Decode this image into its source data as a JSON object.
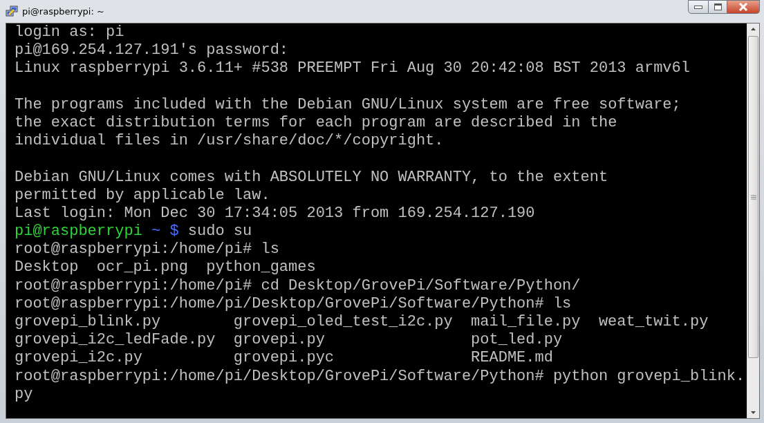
{
  "window": {
    "title": "pi@raspberrypi: ~"
  },
  "terminal": {
    "lines": [
      {
        "kind": "text",
        "text": "login as: pi"
      },
      {
        "kind": "text",
        "text": "pi@169.254.127.191's password:"
      },
      {
        "kind": "text",
        "text": "Linux raspberrypi 3.6.11+ #538 PREEMPT Fri Aug 30 20:42:08 BST 2013 armv6l"
      },
      {
        "kind": "blank"
      },
      {
        "kind": "text",
        "text": "The programs included with the Debian GNU/Linux system are free software;"
      },
      {
        "kind": "text",
        "text": "the exact distribution terms for each program are described in the"
      },
      {
        "kind": "text",
        "text": "individual files in /usr/share/doc/*/copyright."
      },
      {
        "kind": "blank"
      },
      {
        "kind": "text",
        "text": "Debian GNU/Linux comes with ABSOLUTELY NO WARRANTY, to the extent"
      },
      {
        "kind": "text",
        "text": "permitted by applicable law."
      },
      {
        "kind": "text",
        "text": "Last login: Mon Dec 30 17:34:05 2013 from 169.254.127.190"
      },
      {
        "kind": "color-prompt",
        "user_host": "pi@raspberrypi",
        "path_prompt": "~ $",
        "command": "sudo su"
      },
      {
        "kind": "prompt",
        "prompt": "root@raspberrypi:/home/pi#",
        "command": "ls"
      },
      {
        "kind": "listing",
        "rows": [
          [
            "Desktop",
            "ocr_pi.png",
            "python_games"
          ]
        ]
      },
      {
        "kind": "prompt",
        "prompt": "root@raspberrypi:/home/pi#",
        "command": "cd Desktop/GrovePi/Software/Python/"
      },
      {
        "kind": "prompt",
        "prompt": "root@raspberrypi:/home/pi/Desktop/GrovePi/Software/Python#",
        "command": "ls"
      },
      {
        "kind": "listing",
        "rows": [
          [
            "grovepi_blink.py",
            "grovepi_oled_test_i2c.py",
            "mail_file.py",
            "weat_twit.py"
          ],
          [
            "grovepi_i2c_ledFade.py",
            "grovepi.py",
            "pot_led.py"
          ],
          [
            "grovepi_i2c.py",
            "grovepi.pyc",
            "README.md"
          ]
        ]
      },
      {
        "kind": "prompt",
        "prompt": "root@raspberrypi:/home/pi/Desktop/GrovePi/Software/Python#",
        "command": "python grovepi_blink."
      },
      {
        "kind": "text",
        "text": "py"
      }
    ]
  }
}
